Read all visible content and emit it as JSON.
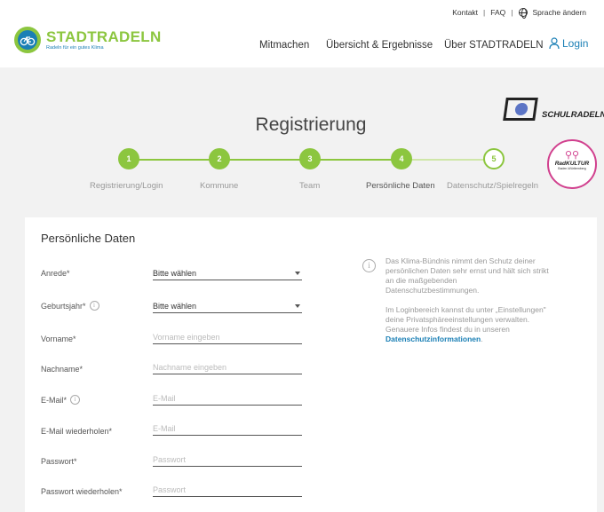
{
  "topbar": {
    "kontakt": "Kontakt",
    "faq": "FAQ",
    "sprache": "Sprache ändern",
    "separator": "|"
  },
  "brand": {
    "title": "STADTRADELN",
    "subtitle": "Radeln für ein gutes Klima"
  },
  "nav": {
    "mitmachen": "Mitmachen",
    "uebersicht": "Übersicht & Ergebnisse",
    "ueber": "Über STADTRADELN",
    "login": "Login"
  },
  "page": {
    "title": "Registrierung"
  },
  "logos": {
    "schulradeln": "SCHULRADELN",
    "radkultur": "RadKULTUR",
    "radkultur_sub": "Baden-Württemberg"
  },
  "steps": [
    {
      "number": "1",
      "label": "Registrierung/Login",
      "state": "done"
    },
    {
      "number": "2",
      "label": "Kommune",
      "state": "done"
    },
    {
      "number": "3",
      "label": "Team",
      "state": "done"
    },
    {
      "number": "4",
      "label": "Persönliche Daten",
      "state": "active"
    },
    {
      "number": "5",
      "label": "Datenschutz/Spielregeln",
      "state": "todo"
    }
  ],
  "form": {
    "title": "Persönliche Daten",
    "fields": [
      {
        "label": "Anrede*",
        "value": "Bitte wählen",
        "type": "select"
      },
      {
        "label": "Geburtsjahr*",
        "value": "Bitte wählen",
        "type": "select",
        "info": "i"
      },
      {
        "label": "Vorname*",
        "placeholder": "Vorname eingeben",
        "type": "text"
      },
      {
        "label": "Nachname*",
        "placeholder": "Nachname eingeben",
        "type": "text"
      },
      {
        "label": "E-Mail*",
        "placeholder": "E-Mail",
        "type": "text",
        "info": "i"
      },
      {
        "label": "E-Mail wiederholen*",
        "placeholder": "E-Mail",
        "type": "text"
      },
      {
        "label": "Passwort*",
        "placeholder": "Passwort",
        "type": "password"
      },
      {
        "label": "Passwort wiederholen*",
        "placeholder": "Passwort",
        "type": "password"
      }
    ]
  },
  "info": {
    "icon": "i",
    "p1": "Das Klima-Bündnis nimmt den Schutz deiner persönlichen Daten sehr ernst und hält sich strikt an die maßgebenden Datenschutzbestimmungen.",
    "p2_text": "Im Loginbereich kannst du unter „Einstellungen\" deine Privatsphäreeinstellungen verwalten. Genauere Infos findest du in unseren",
    "p2_link": "Datenschutzinformationen",
    "p2_end": "."
  },
  "colors": {
    "green": "#8cc63f",
    "blue": "#1a7fb5",
    "pink": "#d1408e"
  }
}
